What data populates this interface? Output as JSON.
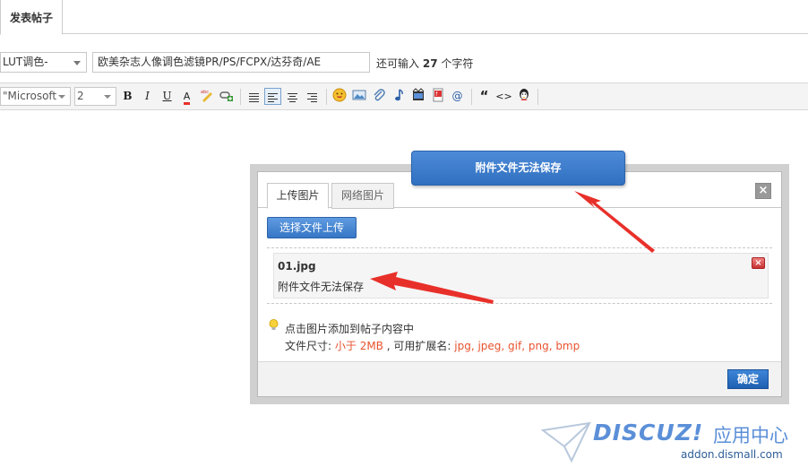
{
  "top_tab": {
    "label": "发表帖子"
  },
  "post_form": {
    "type_select": "LUT调色-",
    "title_value": "欧美杂志人像调色滤镜PR/PS/FCPX/达芬奇/AE",
    "char_hint_prefix": "还可输入",
    "char_hint_count": "27",
    "char_hint_suffix": "个字符"
  },
  "toolbar": {
    "font_family": "\"Microsoft",
    "font_size": "2",
    "bold": "B",
    "italic": "I",
    "underline": "U",
    "font_color": "A",
    "quote": "“",
    "code": "<>",
    "email": "@",
    "icons": [
      "bold-icon",
      "italic-icon",
      "underline-icon",
      "font-color-icon",
      "spellcheck-icon",
      "link-icon",
      "align-left-icon",
      "align-left-active-icon",
      "align-center-icon",
      "align-right-icon",
      "smiley-icon",
      "image-icon",
      "attachment-icon",
      "music-icon",
      "video-icon",
      "flash-icon",
      "at-icon",
      "quote-icon",
      "code-icon",
      "user-icon"
    ]
  },
  "upload_dialog": {
    "tab_upload": "上传图片",
    "tab_network": "网络图片",
    "upload_button": "选择文件上传",
    "file": {
      "name": "01.jpg",
      "status": "附件文件无法保存"
    },
    "tip_line1": "点击图片添加到帖子内容中",
    "tip_size_label": "文件尺寸:",
    "tip_size_value": "小于 2MB",
    "tip_ext_label": ", 可用扩展名:",
    "tip_ext_value": "jpg, jpeg, gif, png, bmp",
    "ok_button": "确定"
  },
  "error_notice": {
    "text": "附件文件无法保存"
  },
  "watermark": {
    "logo": "DISCUZ!",
    "suffix": "应用中心",
    "url": "addon.dismall.com"
  },
  "colors": {
    "accent": "#3676c6",
    "notice": "#3d7ccc",
    "error_red": "#e8532f",
    "arrow_red": "#e8302a"
  }
}
